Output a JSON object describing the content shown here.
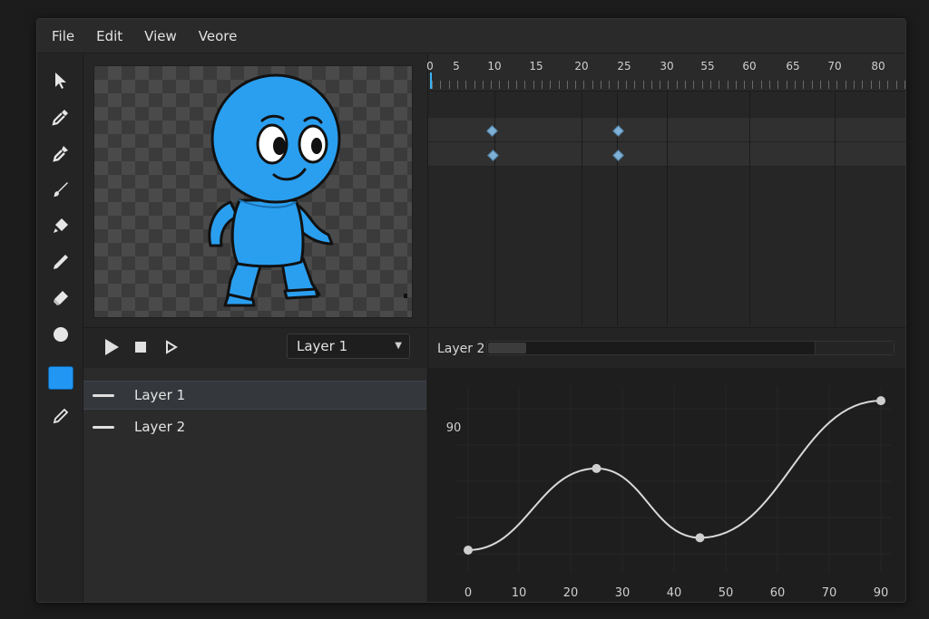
{
  "menu": [
    "File",
    "Edit",
    "View",
    "Veore"
  ],
  "tools": [
    {
      "name": "select-arrow-icon"
    },
    {
      "name": "eyedropper-icon"
    },
    {
      "name": "pipette-icon"
    },
    {
      "name": "brush-icon"
    },
    {
      "name": "fill-icon"
    },
    {
      "name": "pencil-icon"
    },
    {
      "name": "eraser-icon"
    },
    {
      "name": "circle-icon"
    }
  ],
  "colors": {
    "accent": "#2196f3",
    "character": "#2a9ff0",
    "playhead": "#3ab4f2"
  },
  "transport": {
    "layer_select": "Layer 1"
  },
  "layers": [
    {
      "label": "Layer 1",
      "selected": true
    },
    {
      "label": "Layer 2",
      "selected": false
    }
  ],
  "timeline": {
    "ruler_labels": [
      "0",
      "5",
      "10",
      "15",
      "20",
      "25",
      "30",
      "55",
      "60",
      "65",
      "70",
      "80"
    ],
    "keyframes": [
      {
        "track": 1,
        "frame": 10
      },
      {
        "track": 1,
        "frame": 25
      },
      {
        "track": 2,
        "frame": 10
      },
      {
        "track": 2,
        "frame": 25
      }
    ]
  },
  "graph_header": {
    "label": "Layer 2"
  },
  "chart_data": {
    "type": "line",
    "title": "",
    "xlabel": "",
    "ylabel": "",
    "x_ticks": [
      "0",
      "10",
      "20",
      "30",
      "40",
      "50",
      "60",
      "70",
      "90"
    ],
    "y_ticks": [
      "90"
    ],
    "points": [
      {
        "x": 0,
        "y": 10
      },
      {
        "x": 25,
        "y": 63
      },
      {
        "x": 45,
        "y": 18
      },
      {
        "x": 90,
        "y": 107
      }
    ]
  }
}
